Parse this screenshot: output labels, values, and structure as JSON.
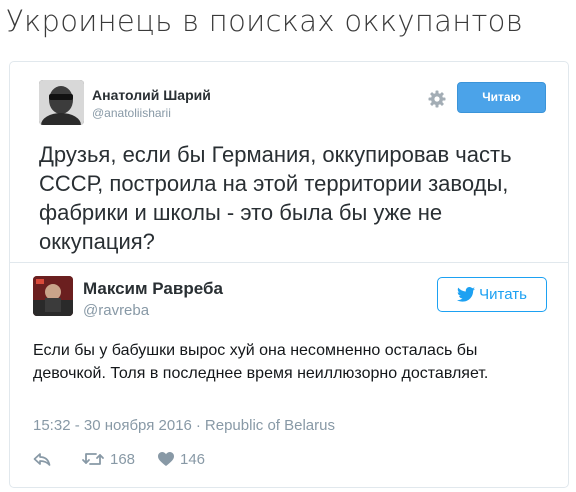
{
  "headline": "Укроинець в поисках оккупантов",
  "quoted_tweet": {
    "author_name": "Анатолий Шарий",
    "author_handle": "@anatoliisharii",
    "follow_label": "Читаю",
    "text": "Друзья, если бы Германия, оккупировав часть СССР, построила на этой территории заводы, фабрики и школы - это была бы уже не оккупация?"
  },
  "reply_tweet": {
    "author_name": "Максим Равреба",
    "author_handle": "@ravreba",
    "follow_label": "Читать",
    "text": "Если бы у бабушки вырос хуй она несомненно осталась бы девочкой. Толя в последнее время неиллюзорно доставляет.",
    "timestamp": "15:32 - 30 ноября 2016",
    "meta_separator": "·",
    "location": "Republic of Belarus",
    "retweet_count": "168",
    "like_count": "146"
  },
  "colors": {
    "accent": "#1da1f2",
    "follow_filled": "#4ba3e9",
    "muted": "#8899a6",
    "border": "#e1e8ed"
  }
}
